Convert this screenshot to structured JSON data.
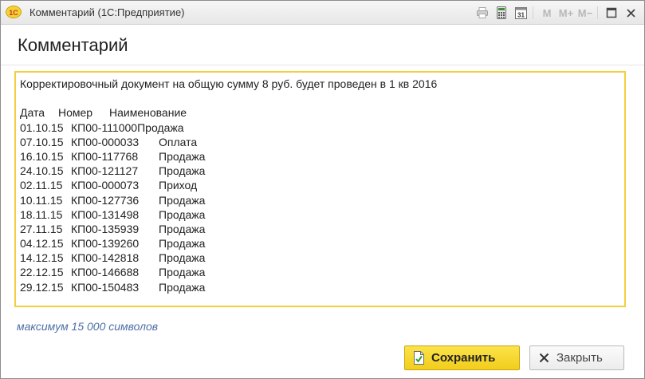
{
  "window": {
    "app_logo": "1С",
    "title": "Комментарий (1С:Предприятие)",
    "toolbar": {
      "m_label": "M",
      "m_plus_label": "M+",
      "m_minus_label": "M−",
      "calendar_day": "31"
    }
  },
  "header": {
    "title": "Комментарий"
  },
  "comment": {
    "intro": "Корректировочный документ на общую сумму 8 руб. будет проведен в 1 кв 2016",
    "columns": {
      "date": "Дата",
      "number": "Номер",
      "name": "Наименование"
    },
    "rows": [
      {
        "date": "01.10.15",
        "number": "КП00-111000",
        "name": "Продажа"
      },
      {
        "date": "07.10.15",
        "number": "КП00-000033",
        "name": "Оплата"
      },
      {
        "date": "16.10.15",
        "number": "КП00-117768",
        "name": "Продажа"
      },
      {
        "date": "24.10.15",
        "number": "КП00-121127",
        "name": "Продажа"
      },
      {
        "date": "02.11.15",
        "number": "КП00-000073",
        "name": "Приход"
      },
      {
        "date": "10.11.15",
        "number": "КП00-127736",
        "name": "Продажа"
      },
      {
        "date": "18.11.15",
        "number": "КП00-131498",
        "name": "Продажа"
      },
      {
        "date": "27.11.15",
        "number": "КП00-135939",
        "name": "Продажа"
      },
      {
        "date": "04.12.15",
        "number": "КП00-139260",
        "name": "Продажа"
      },
      {
        "date": "14.12.15",
        "number": "КП00-142818",
        "name": "Продажа"
      },
      {
        "date": "22.12.15",
        "number": "КП00-146688",
        "name": "Продажа"
      },
      {
        "date": "29.12.15",
        "number": "КП00-150483",
        "name": "Продажа"
      }
    ]
  },
  "limit_text": "максимум 15 000 символов",
  "buttons": {
    "save": "Сохранить",
    "close": "Закрыть"
  },
  "icons": {
    "print": "printer-icon",
    "calculator": "calculator-icon",
    "calendar": "calendar-icon",
    "maximize": "maximize-icon",
    "close": "close-icon",
    "save": "document-check-icon",
    "close_button": "x-icon"
  },
  "colors": {
    "accent_yellow": "#f3cf3e",
    "limit_text": "#4f6fa8"
  }
}
